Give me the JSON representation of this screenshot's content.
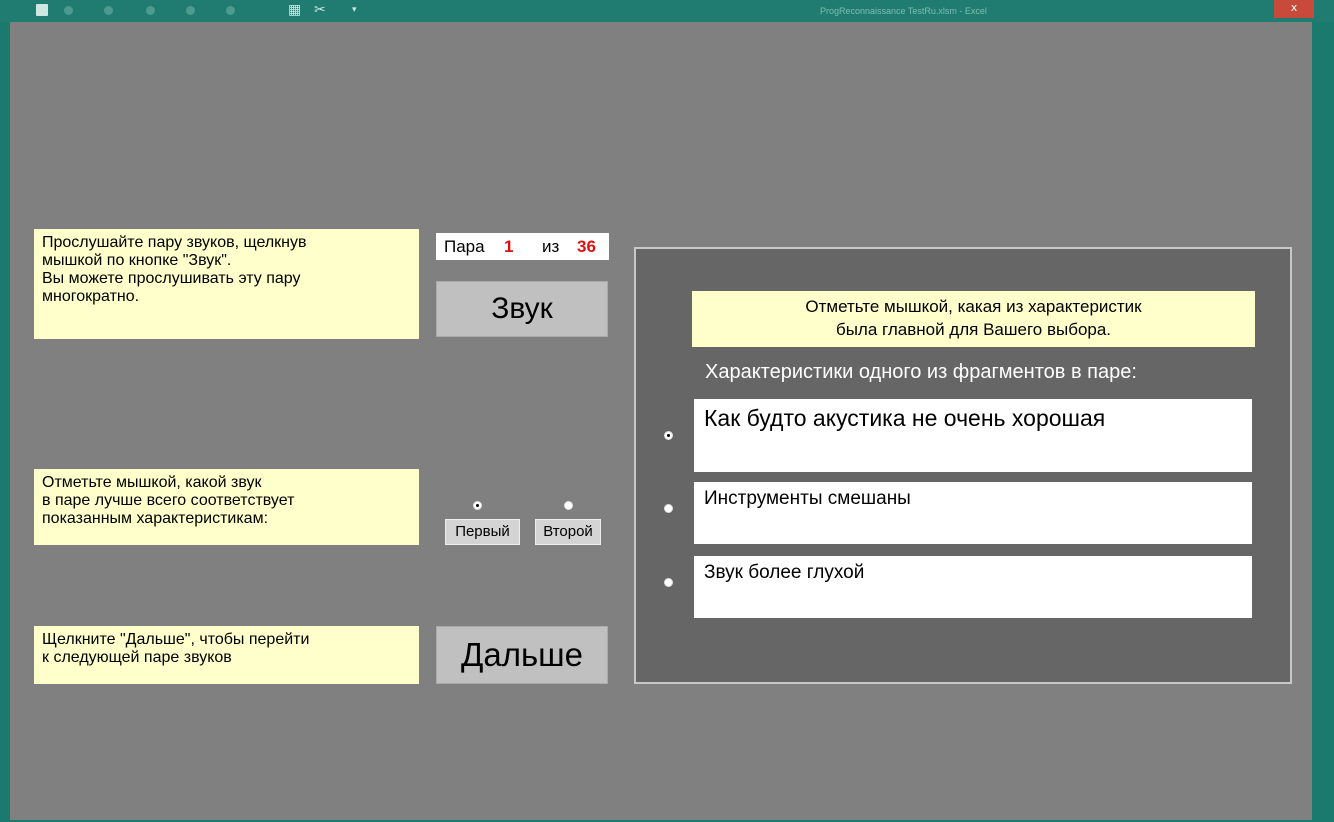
{
  "window": {
    "title": "ProgReconnaissance TestRu.xlsm - Excel",
    "close_glyph": "x"
  },
  "instructions": {
    "listen": "Прослушайте пару звуков, щелкнув\nмышкой по кнопке \"Звук\".\nВы можете прослушивать эту пару\nмногократно.",
    "choose": "Отметьте мышкой, какой звук\nв паре лучше всего соответствует\nпоказанным характеристикам:",
    "next": "Щелкните \"Дальше\", чтобы перейти\nк следующей паре звуков"
  },
  "pair_counter": {
    "label": "Пара",
    "current": "1",
    "of_label": "из",
    "total": "36"
  },
  "buttons": {
    "sound": "Звук",
    "next": "Дальше"
  },
  "sound_choice": {
    "options": [
      {
        "label": "Первый",
        "checked": true
      },
      {
        "label": "Второй",
        "checked": false
      }
    ]
  },
  "characteristics_panel": {
    "instruction": "Отметьте мышкой, какая из характеристик\nбыла главной для Вашего выбора.",
    "caption": "Характеристики одного из фрагментов в паре:",
    "items": [
      {
        "text": "Как будто акустика не очень хорошая",
        "checked": true
      },
      {
        "text": "Инструменты смешаны",
        "checked": false
      },
      {
        "text": "Звук более глухой",
        "checked": false
      }
    ]
  },
  "colors": {
    "background": "#808080",
    "note_fill": "#ffffcc",
    "panel_fill": "#666666",
    "counter_red": "#e01010",
    "button_fill": "#c0c0c0"
  }
}
